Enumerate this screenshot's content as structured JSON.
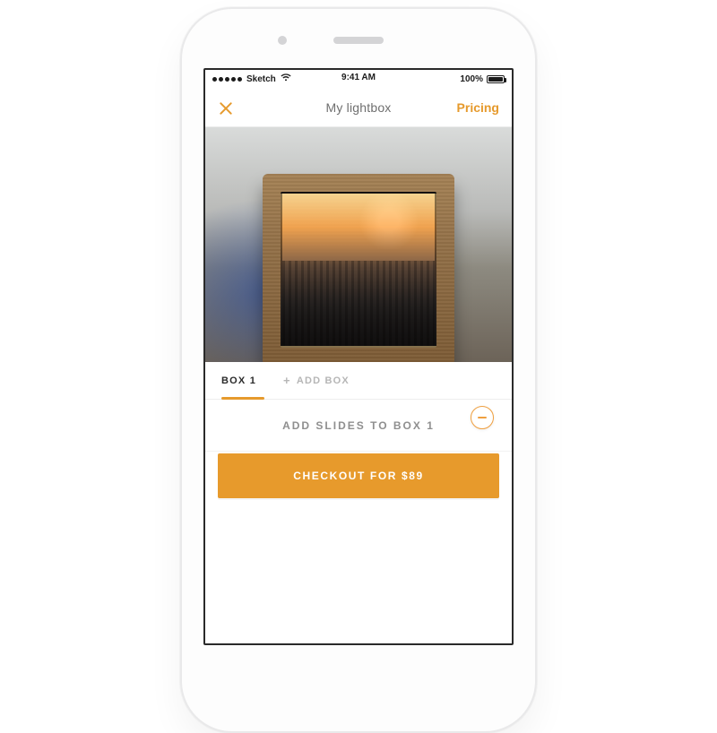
{
  "status_bar": {
    "carrier": "Sketch",
    "time": "9:41 AM",
    "battery": "100%",
    "wifi_icon": "wifi"
  },
  "nav": {
    "title": "My lightbox",
    "right_label": "Pricing",
    "close_icon": "close"
  },
  "tabs": {
    "active": "BOX 1",
    "add_label": "ADD BOX"
  },
  "instruction": {
    "text": "ADD SLIDES TO BOX 1"
  },
  "checkout": {
    "label": "CHECKOUT FOR $89"
  },
  "colors": {
    "accent": "#e79a2c"
  }
}
